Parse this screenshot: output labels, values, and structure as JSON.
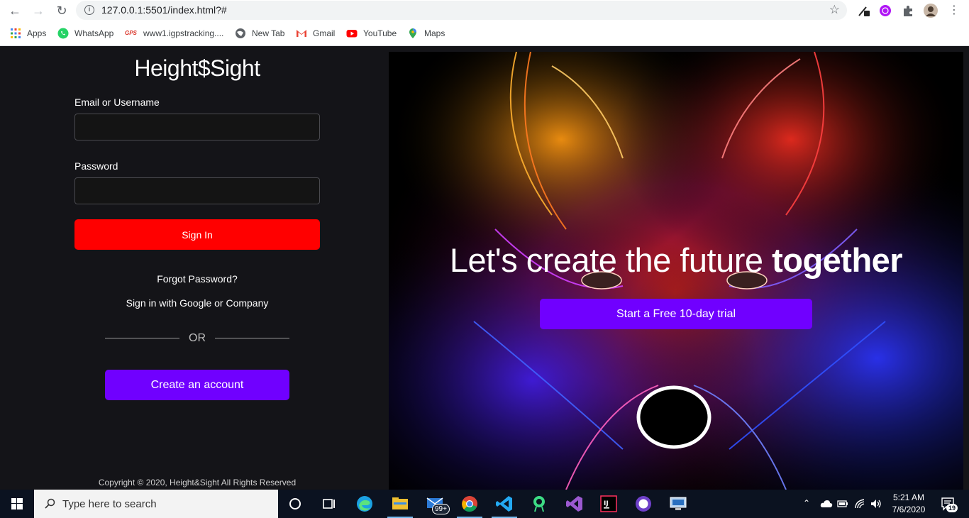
{
  "browser": {
    "url": "127.0.0.1:5501/index.html?#",
    "bookmarks": [
      {
        "label": "Apps",
        "icon": "apps-grid-icon",
        "color": "#4285f4"
      },
      {
        "label": "WhatsApp",
        "icon": "whatsapp-icon",
        "color": "#25d366"
      },
      {
        "label": "www1.igpstracking....",
        "icon": "gps-icon",
        "color": "#d93025"
      },
      {
        "label": "New Tab",
        "icon": "globe-icon",
        "color": "#5f6368"
      },
      {
        "label": "Gmail",
        "icon": "gmail-icon",
        "color": "#ea4335"
      },
      {
        "label": "YouTube",
        "icon": "youtube-icon",
        "color": "#ff0000"
      },
      {
        "label": "Maps",
        "icon": "maps-pin-icon",
        "color": "#34a853"
      }
    ]
  },
  "login": {
    "brand": "Height$Sight",
    "email_label": "Email or Username",
    "email_value": "",
    "password_label": "Password",
    "password_value": "",
    "signin_label": "Sign In",
    "forgot_label": "Forgot Password?",
    "sso_label": "Sign in with Google or Company",
    "or_label": "OR",
    "create_label": "Create an account",
    "copyright": "Copyright © 2020, Height&Sight All Rights Reserved"
  },
  "hero": {
    "tagline_light": "Let's create the future ",
    "tagline_bold": "together",
    "trial_label": "Start a Free 10-day trial"
  },
  "taskbar": {
    "search_placeholder": "Type here to search",
    "time": "5:21 AM",
    "date": "7/6/2020",
    "mail_badge": "99+",
    "notification_count": "19"
  },
  "colors": {
    "accent_purple": "#7000ff",
    "signin_red": "#ff0000",
    "panel_bg": "#141418"
  }
}
